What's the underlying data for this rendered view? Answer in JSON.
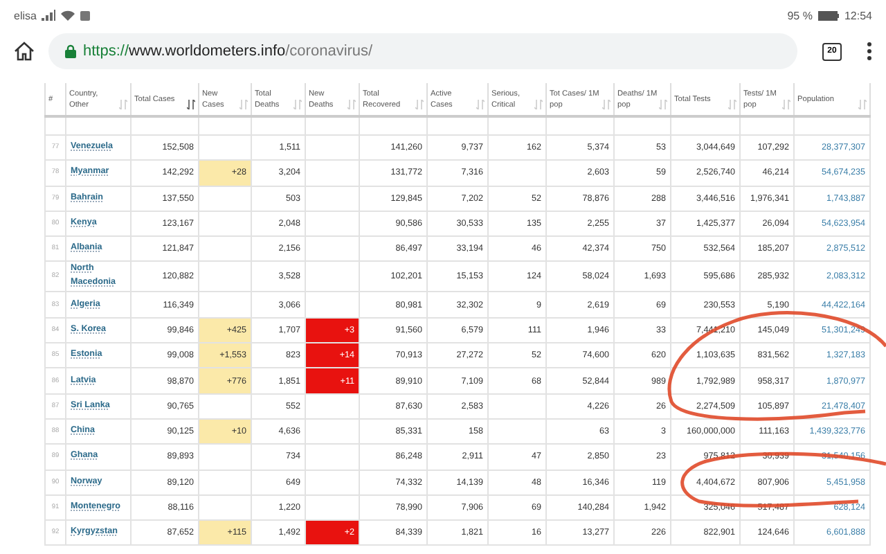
{
  "status_bar": {
    "carrier": "elisa",
    "battery": "95 %",
    "time": "12:54"
  },
  "address_bar": {
    "scheme": "https://",
    "host": "www.worldometers.info",
    "path": "/coronavirus/",
    "tab_count": "20"
  },
  "table": {
    "columns": [
      {
        "label": "#",
        "kind": "rank"
      },
      {
        "label": "Country, Other",
        "kind": "country",
        "sorted": false
      },
      {
        "label": "Total Cases",
        "kind": "total_cases",
        "sorted": true
      },
      {
        "label": "New Cases",
        "kind": "new_cases",
        "sorted": false
      },
      {
        "label": "Total Deaths",
        "kind": "total_deaths",
        "sorted": false
      },
      {
        "label": "New Deaths",
        "kind": "new_deaths",
        "sorted": false
      },
      {
        "label": "Total Recovered",
        "kind": "total_recovered",
        "sorted": false
      },
      {
        "label": "Active Cases",
        "kind": "active_cases",
        "sorted": false
      },
      {
        "label": "Serious, Critical",
        "kind": "serious_critical",
        "sorted": false
      },
      {
        "label": "Tot Cases/ 1M pop",
        "kind": "cases_per_1m",
        "sorted": false
      },
      {
        "label": "Deaths/ 1M pop",
        "kind": "deaths_per_1m",
        "sorted": false
      },
      {
        "label": "Total Tests",
        "kind": "total_tests",
        "sorted": false
      },
      {
        "label": "Tests/ 1M pop",
        "kind": "tests_per_1m",
        "sorted": false
      },
      {
        "label": "Population",
        "kind": "population",
        "sorted": false
      }
    ],
    "rows": [
      {
        "rank": "77",
        "country": "Venezuela",
        "total_cases": "152,508",
        "total_deaths": "1,511",
        "total_recovered": "141,260",
        "active_cases": "9,737",
        "serious_critical": "162",
        "cases_per_1m": "5,374",
        "deaths_per_1m": "53",
        "total_tests": "3,044,649",
        "tests_per_1m": "107,292",
        "population": "28,377,307"
      },
      {
        "rank": "78",
        "country": "Myanmar",
        "total_cases": "142,292",
        "new_cases": "+28",
        "total_deaths": "3,204",
        "total_recovered": "131,772",
        "active_cases": "7,316",
        "cases_per_1m": "2,603",
        "deaths_per_1m": "59",
        "total_tests": "2,526,740",
        "tests_per_1m": "46,214",
        "population": "54,674,235"
      },
      {
        "rank": "79",
        "country": "Bahrain",
        "total_cases": "137,550",
        "total_deaths": "503",
        "total_recovered": "129,845",
        "active_cases": "7,202",
        "serious_critical": "52",
        "cases_per_1m": "78,876",
        "deaths_per_1m": "288",
        "total_tests": "3,446,516",
        "tests_per_1m": "1,976,341",
        "population": "1,743,887"
      },
      {
        "rank": "80",
        "country": "Kenya",
        "total_cases": "123,167",
        "total_deaths": "2,048",
        "total_recovered": "90,586",
        "active_cases": "30,533",
        "serious_critical": "135",
        "cases_per_1m": "2,255",
        "deaths_per_1m": "37",
        "total_tests": "1,425,377",
        "tests_per_1m": "26,094",
        "population": "54,623,954"
      },
      {
        "rank": "81",
        "country": "Albania",
        "total_cases": "121,847",
        "total_deaths": "2,156",
        "total_recovered": "86,497",
        "active_cases": "33,194",
        "serious_critical": "46",
        "cases_per_1m": "42,374",
        "deaths_per_1m": "750",
        "total_tests": "532,564",
        "tests_per_1m": "185,207",
        "population": "2,875,512"
      },
      {
        "rank": "82",
        "country": "North Macedonia",
        "total_cases": "120,882",
        "total_deaths": "3,528",
        "total_recovered": "102,201",
        "active_cases": "15,153",
        "serious_critical": "124",
        "cases_per_1m": "58,024",
        "deaths_per_1m": "1,693",
        "total_tests": "595,686",
        "tests_per_1m": "285,932",
        "population": "2,083,312"
      },
      {
        "rank": "83",
        "country": "Algeria",
        "total_cases": "116,349",
        "total_deaths": "3,066",
        "total_recovered": "80,981",
        "active_cases": "32,302",
        "serious_critical": "9",
        "cases_per_1m": "2,619",
        "deaths_per_1m": "69",
        "total_tests": "230,553",
        "tests_per_1m": "5,190",
        "population": "44,422,164"
      },
      {
        "rank": "84",
        "country": "S. Korea",
        "total_cases": "99,846",
        "new_cases": "+425",
        "total_deaths": "1,707",
        "new_deaths": "+3",
        "total_recovered": "91,560",
        "active_cases": "6,579",
        "serious_critical": "111",
        "cases_per_1m": "1,946",
        "deaths_per_1m": "33",
        "total_tests": "7,441,210",
        "tests_per_1m": "145,049",
        "population": "51,301,249"
      },
      {
        "rank": "85",
        "country": "Estonia",
        "total_cases": "99,008",
        "new_cases": "+1,553",
        "total_deaths": "823",
        "new_deaths": "+14",
        "total_recovered": "70,913",
        "active_cases": "27,272",
        "serious_critical": "52",
        "cases_per_1m": "74,600",
        "deaths_per_1m": "620",
        "total_tests": "1,103,635",
        "tests_per_1m": "831,562",
        "population": "1,327,183"
      },
      {
        "rank": "86",
        "country": "Latvia",
        "total_cases": "98,870",
        "new_cases": "+776",
        "total_deaths": "1,851",
        "new_deaths": "+11",
        "total_recovered": "89,910",
        "active_cases": "7,109",
        "serious_critical": "68",
        "cases_per_1m": "52,844",
        "deaths_per_1m": "989",
        "total_tests": "1,792,989",
        "tests_per_1m": "958,317",
        "population": "1,870,977"
      },
      {
        "rank": "87",
        "country": "Sri Lanka",
        "total_cases": "90,765",
        "total_deaths": "552",
        "total_recovered": "87,630",
        "active_cases": "2,583",
        "cases_per_1m": "4,226",
        "deaths_per_1m": "26",
        "total_tests": "2,274,509",
        "tests_per_1m": "105,897",
        "population": "21,478,407"
      },
      {
        "rank": "88",
        "country": "China",
        "total_cases": "90,125",
        "new_cases": "+10",
        "total_deaths": "4,636",
        "total_recovered": "85,331",
        "active_cases": "158",
        "cases_per_1m": "63",
        "deaths_per_1m": "3",
        "total_tests": "160,000,000",
        "tests_per_1m": "111,163",
        "population": "1,439,323,776"
      },
      {
        "rank": "89",
        "country": "Ghana",
        "total_cases": "89,893",
        "total_deaths": "734",
        "total_recovered": "86,248",
        "active_cases": "2,911",
        "serious_critical": "47",
        "cases_per_1m": "2,850",
        "deaths_per_1m": "23",
        "total_tests": "975,812",
        "tests_per_1m": "30,939",
        "population": "31,540,156"
      },
      {
        "rank": "90",
        "country": "Norway",
        "total_cases": "89,120",
        "total_deaths": "649",
        "total_recovered": "74,332",
        "active_cases": "14,139",
        "serious_critical": "48",
        "cases_per_1m": "16,346",
        "deaths_per_1m": "119",
        "total_tests": "4,404,672",
        "tests_per_1m": "807,906",
        "population": "5,451,958"
      },
      {
        "rank": "91",
        "country": "Montenegro",
        "total_cases": "88,116",
        "total_deaths": "1,220",
        "total_recovered": "78,990",
        "active_cases": "7,906",
        "serious_critical": "69",
        "cases_per_1m": "140,284",
        "deaths_per_1m": "1,942",
        "total_tests": "325,046",
        "tests_per_1m": "517,487",
        "population": "628,124"
      },
      {
        "rank": "92",
        "country": "Kyrgyzstan",
        "total_cases": "87,652",
        "new_cases": "+115",
        "total_deaths": "1,492",
        "new_deaths": "+2",
        "total_recovered": "84,339",
        "active_cases": "1,821",
        "serious_critical": "16",
        "cases_per_1m": "13,277",
        "deaths_per_1m": "226",
        "total_tests": "822,901",
        "tests_per_1m": "124,646",
        "population": "6,601,888"
      }
    ]
  }
}
